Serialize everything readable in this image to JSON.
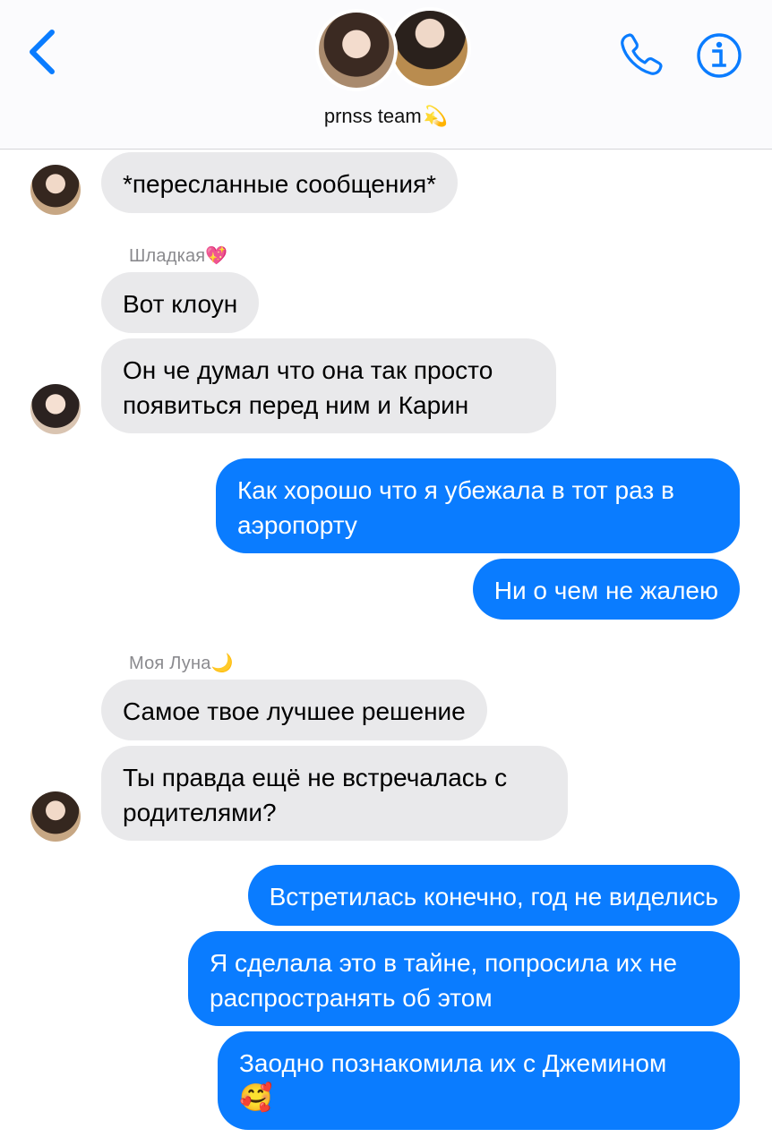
{
  "header": {
    "group_name": "prnss team",
    "group_emoji": "💫"
  },
  "icons": {
    "back": "chevron-left-icon",
    "call": "phone-icon",
    "info": "info-icon"
  },
  "colors": {
    "accent": "#0a7cff",
    "incoming_bubble": "#e9e9eb",
    "sender_name": "#8a8a8e"
  },
  "messages": {
    "m1": "*пересланные сообщения*",
    "sender1_name": "Шладкая",
    "sender1_emoji": "💖",
    "m2": "Вот клоун",
    "m3_line1": "Он че думал что она так просто",
    "m3_line2": "появиться перед ним и Карин",
    "m4_line1": "Как хорошо что я убежала в тот раз в",
    "m4_line2": "аэропорту",
    "m5": "Ни о чем  не жалею",
    "sender2_name": "Моя Луна",
    "sender2_emoji": "🌙",
    "m6": "Самое твое лучшее решение",
    "m7_line1": "Ты правда ещё не встречалась с",
    "m7_line2": "родителями?",
    "m8": "Встретилась конечно, год не виделись",
    "m9_line1": "Я сделала это в тайне, попросила их не",
    "m9_line2": "распространять об этом",
    "m10_line1": "Заодно познакомила их с Джемином",
    "m10_emoji": "🥰"
  }
}
